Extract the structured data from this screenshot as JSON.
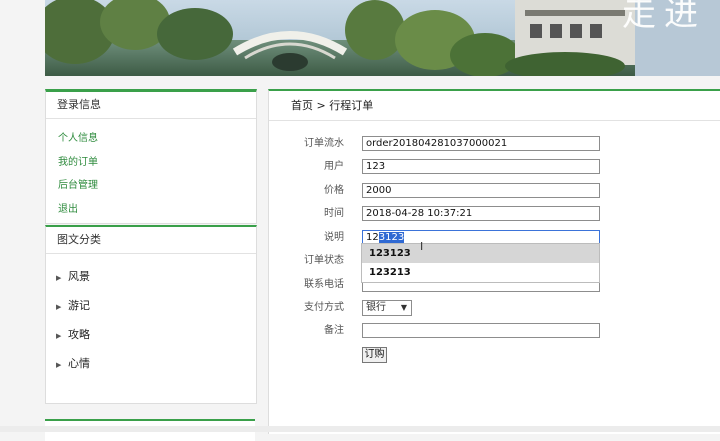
{
  "banner": {
    "title": "走进"
  },
  "login_panel": {
    "title": "登录信息",
    "items": [
      "个人信息",
      "我的订单",
      "后台管理",
      "退出"
    ]
  },
  "category_panel": {
    "title": "图文分类",
    "items": [
      "风景",
      "游记",
      "攻略",
      "心情"
    ]
  },
  "main": {
    "breadcrumb": "首页 > 行程订单",
    "fields": {
      "order_no": {
        "label": "订单流水",
        "value": "order201804281037000021"
      },
      "user": {
        "label": "用户",
        "value": "123"
      },
      "price": {
        "label": "价格",
        "value": "2000"
      },
      "time": {
        "label": "时间",
        "value": "2018-04-28 10:37:21"
      },
      "desc": {
        "label": "说明",
        "value_plain": "12",
        "value_selected": "3123"
      },
      "status": {
        "label": "订单状态",
        "value": ""
      },
      "phone": {
        "label": "联系电话",
        "value": ""
      },
      "payment": {
        "label": "支付方式",
        "value": "银行"
      },
      "note": {
        "label": "备注",
        "value": ""
      }
    },
    "submit_label": "订购",
    "autocomplete": [
      "123123",
      "123213"
    ]
  },
  "colors": {
    "accent": "#3aa04a",
    "link": "#2e8b3d",
    "selection": "#2f69d3"
  }
}
